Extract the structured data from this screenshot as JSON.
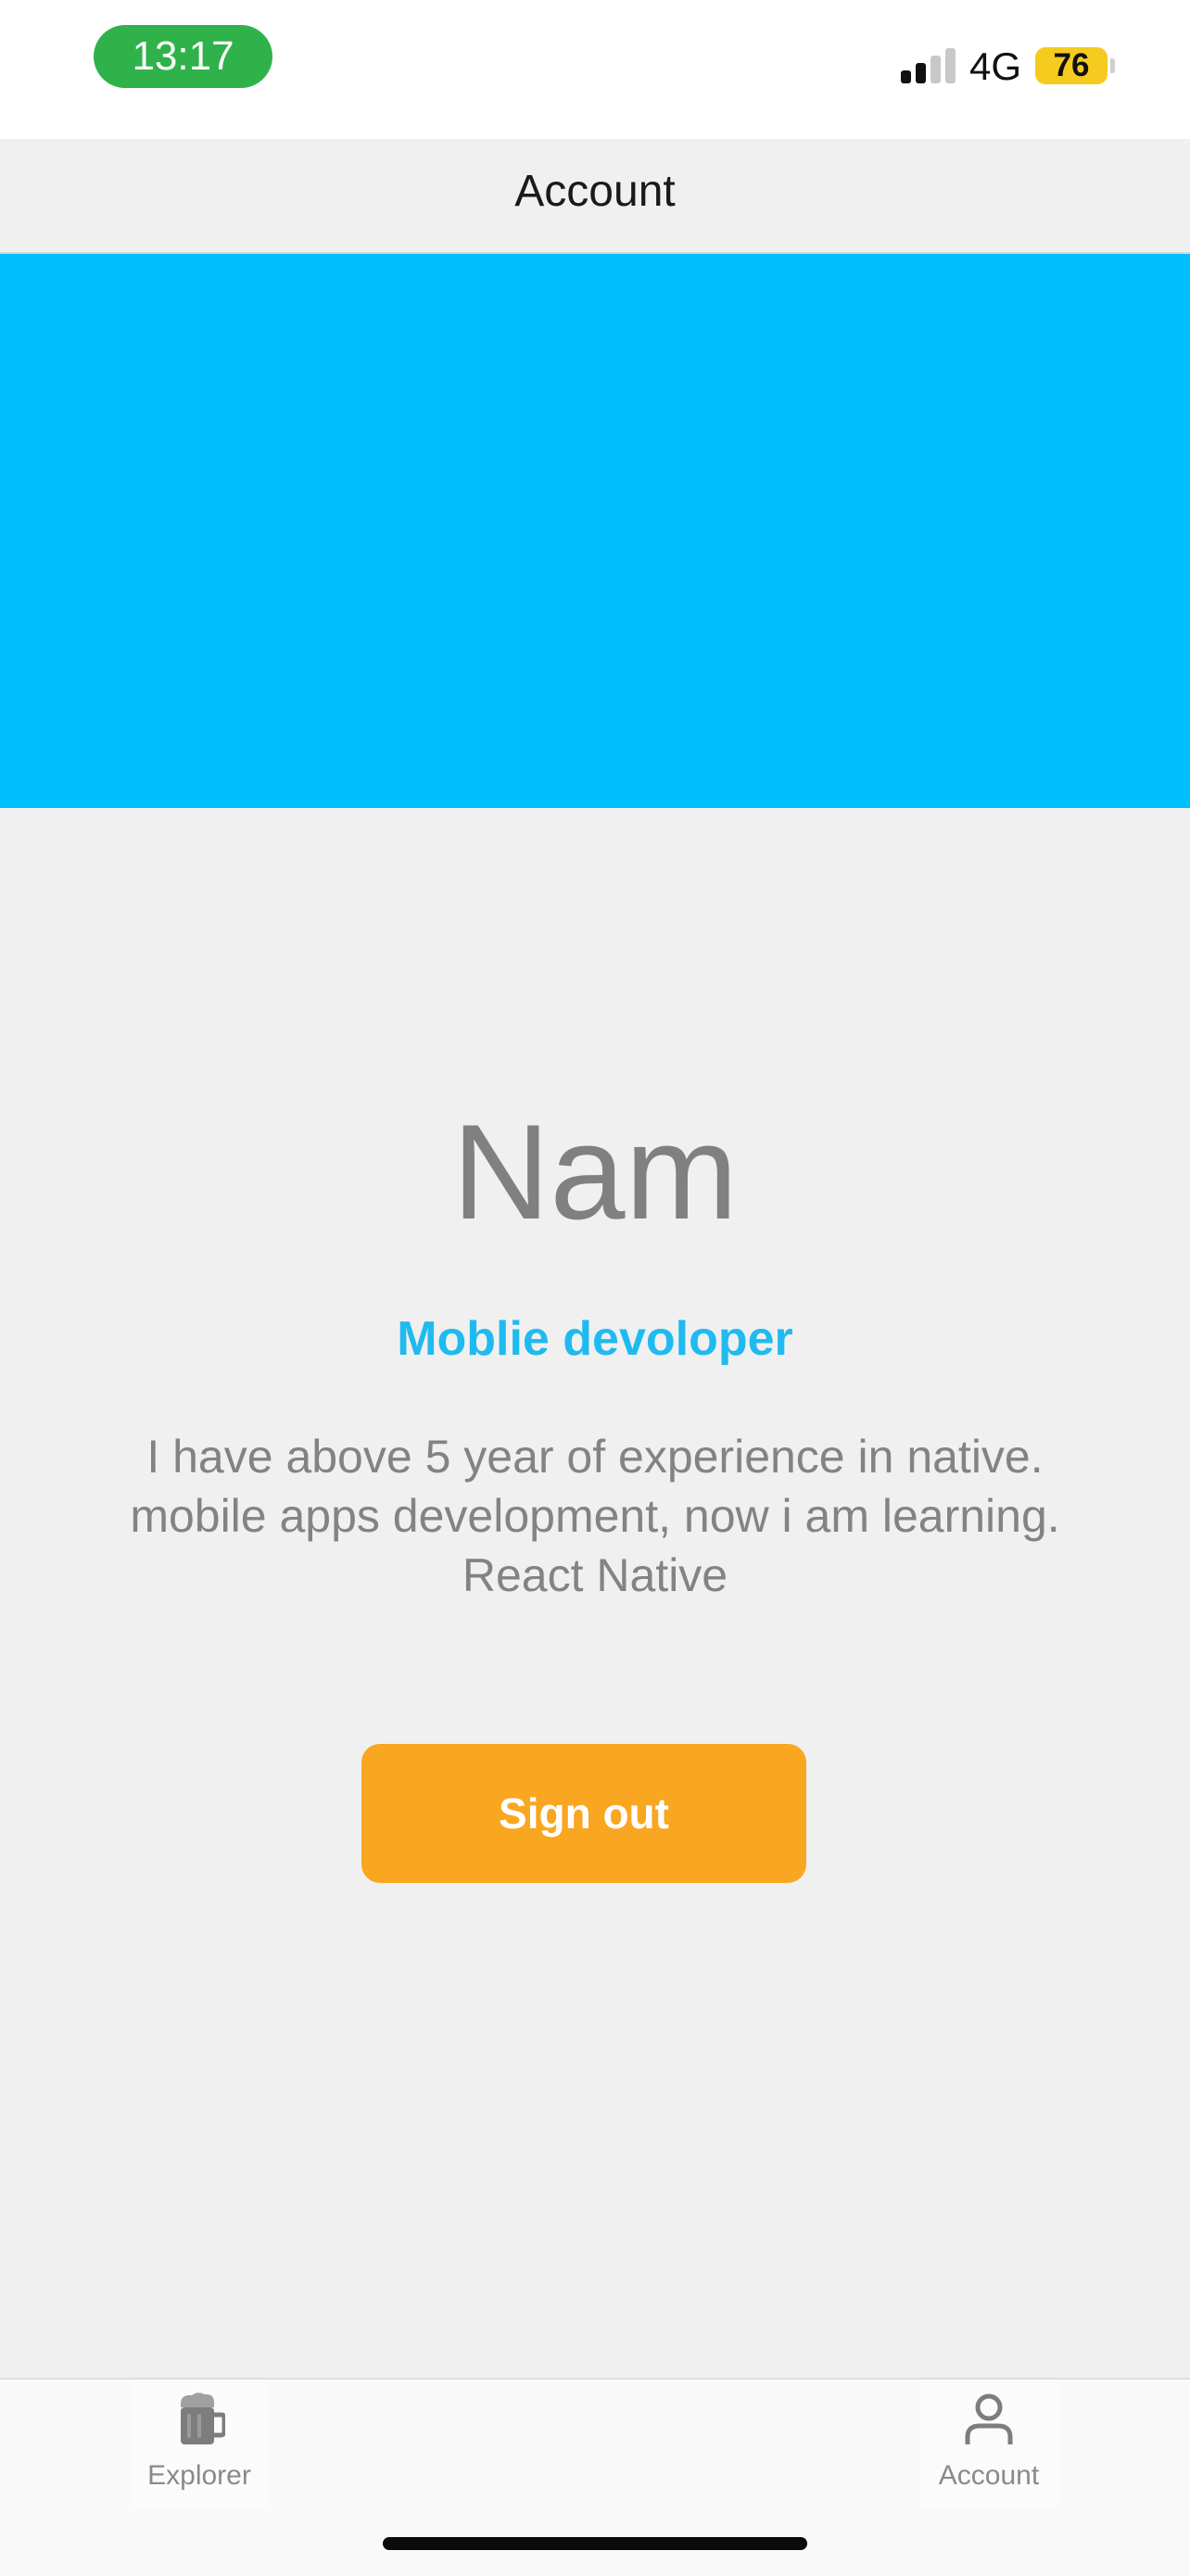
{
  "status_bar": {
    "time": "13:17",
    "network": "4G",
    "battery": "76",
    "signal_bars": 2,
    "signal_total": 4
  },
  "header": {
    "title": "Account"
  },
  "colors": {
    "cover": "#00bfff",
    "role": "#1fbaf0",
    "button": "#f9a620",
    "clock_pill": "#2fb24a",
    "battery": "#f5cb1f"
  },
  "profile": {
    "name": "Nam",
    "role": "Moblie devoloper",
    "bio_lines": [
      "I have above 5 year of experience in native.",
      "mobile apps development, now i am learning.",
      "React Native"
    ],
    "sign_out_label": "Sign out"
  },
  "tab_bar": {
    "items": [
      {
        "label": "Explorer",
        "icon": "beer-mug-icon"
      },
      {
        "label": "Account",
        "icon": "user-icon"
      }
    ]
  }
}
